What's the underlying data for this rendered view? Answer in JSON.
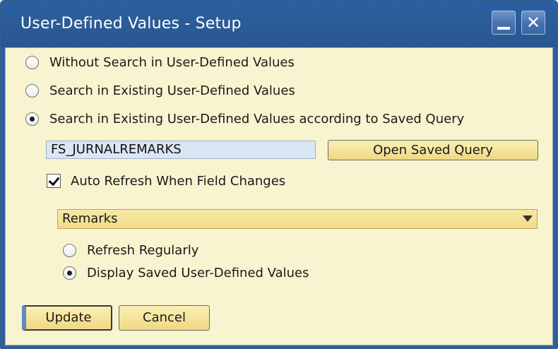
{
  "window": {
    "title": "User-Defined Values - Setup"
  },
  "titlebar": {
    "minimize_icon": "minimize-icon",
    "close_icon": "close-icon",
    "close_glyph": "✕"
  },
  "options": {
    "without_search": "Without Search in User-Defined Values",
    "search_existing": "Search in Existing User-Defined Values",
    "search_saved_query": "Search in Existing User-Defined Values according to Saved Query",
    "selected": "search_saved_query"
  },
  "query": {
    "value": "FS_JURNALREMARKS",
    "open_button": "Open Saved Query"
  },
  "auto_refresh": {
    "label": "Auto Refresh When Field Changes",
    "checked": true
  },
  "field_select": {
    "value": "Remarks"
  },
  "refresh_options": {
    "refresh_regularly": "Refresh Regularly",
    "display_saved": "Display Saved User-Defined Values",
    "selected": "display_saved"
  },
  "footer": {
    "update_label": "Update",
    "cancel_label": "Cancel"
  },
  "colors": {
    "titlebar": "#2b5c98",
    "client_background": "#f8f4cf",
    "button_fill": "#f5e39a",
    "input_fill": "#dbe6f4"
  }
}
